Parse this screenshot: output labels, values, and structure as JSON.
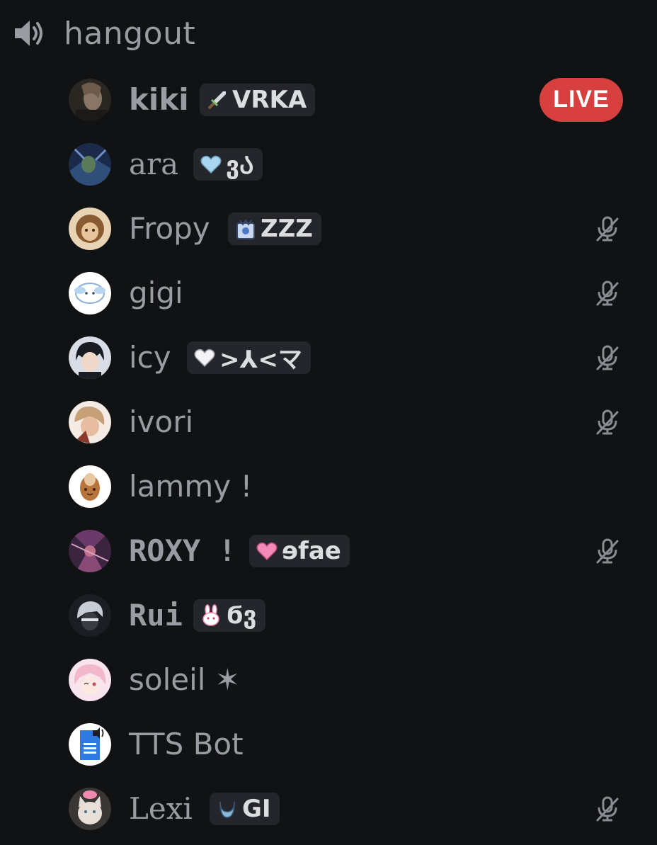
{
  "channel": {
    "name": "hangout",
    "icon": "speaker-icon"
  },
  "colors": {
    "background": "#111214",
    "text": "#9a9ca3",
    "tag_bg": "#24262b",
    "tag_text": "#dcdde1",
    "live": "#d8403f"
  },
  "members": [
    {
      "name": "kiki",
      "tag": "VRKA",
      "tag_icon": "sword-icon",
      "live": "LIVE",
      "muted": false
    },
    {
      "name": "ara",
      "tag": "ვᲐ",
      "tag_icon": "blue-heart-icon",
      "muted": false
    },
    {
      "name": "Fropy",
      "tag": "ZZZ",
      "tag_icon": "crown-badge-icon",
      "muted": true
    },
    {
      "name": "gigi",
      "muted": true
    },
    {
      "name": "icy",
      "tag": ">⅄<マ",
      "tag_icon": "white-heart-icon",
      "muted": true
    },
    {
      "name": "ivori",
      "muted": true
    },
    {
      "name": "lammy !",
      "muted": false
    },
    {
      "name": "ROXY !",
      "tag": "ɘfae",
      "tag_icon": "pink-heart-icon",
      "muted": true
    },
    {
      "name": "Rui",
      "tag": "ϭვ",
      "tag_icon": "bunny-icon",
      "muted": false
    },
    {
      "name": "soleil ✶",
      "muted": false
    },
    {
      "name": "TTS Bot",
      "muted": false
    },
    {
      "name": "Lexi",
      "tag": "GI",
      "tag_icon": "moon-icon",
      "muted": true
    }
  ]
}
